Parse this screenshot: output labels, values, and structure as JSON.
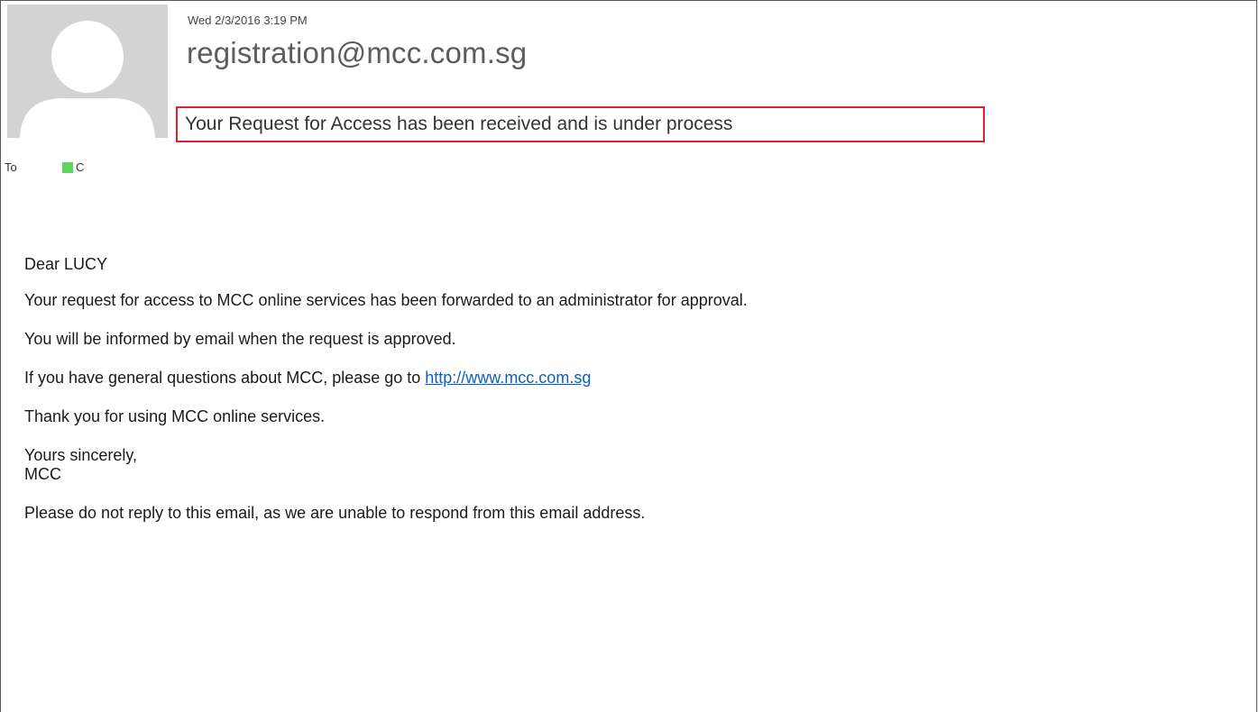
{
  "email": {
    "timestamp": "Wed 2/3/2016 3:19 PM",
    "sender": "registration@mcc.com.sg",
    "subject": "Your Request for Access has been received and is under process",
    "to_label": "To",
    "recipient_initial": "C",
    "recipient_color": "#5fd35f"
  },
  "body": {
    "greeting": "Dear LUCY",
    "line1": "Your request for access to MCC online services has been forwarded to an administrator for approval.",
    "line2": "You will be informed by email when the request is approved.",
    "line3_prefix": "If you have general questions about MCC, please go to ",
    "link": "http://www.mcc.com.sg",
    "line4": "Thank you for using MCC online services.",
    "closing": "Yours sincerely,",
    "signature": "MCC",
    "notice": "Please do not reply to this email, as we are unable to respond from this email address."
  },
  "colors": {
    "highlight_box": "#e0202a",
    "link": "#0b5fbf",
    "avatar_bg": "#d3d3d3"
  }
}
